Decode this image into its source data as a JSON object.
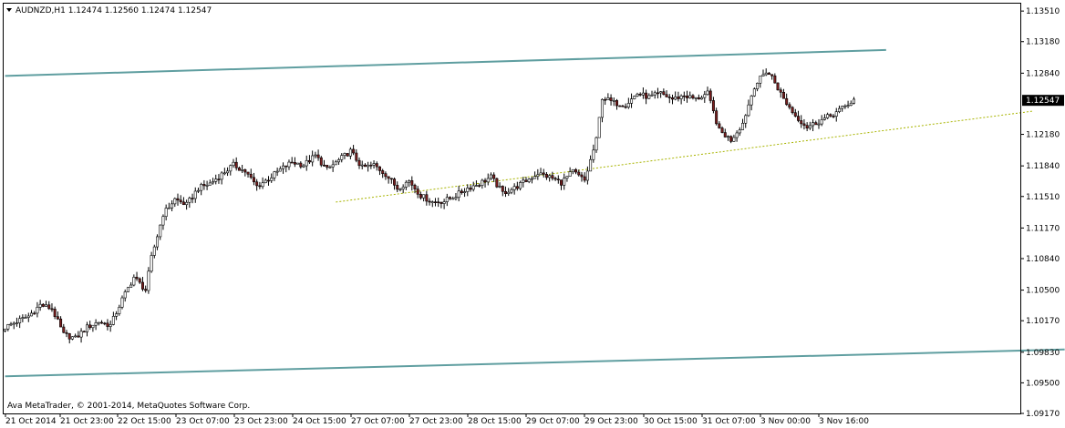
{
  "chart_data": {
    "type": "candlestick",
    "symbol": "AUDNZD",
    "timeframe": "H1",
    "header_text": "AUDNZD,H1  1.12474 1.12560 1.12474 1.12547",
    "ohlc_open": "1.12474",
    "ohlc_high": "1.12560",
    "ohlc_low": "1.12474",
    "ohlc_close": "1.12547",
    "current_price": "1.12547",
    "copyright": "Ava MetaTrader, © 2001-2014, MetaQuotes Software Corp.",
    "y_ticks": [
      "1.13510",
      "1.13180",
      "1.12840",
      "1.12180",
      "1.11840",
      "1.11510",
      "1.11170",
      "1.10840",
      "1.10500",
      "1.10170",
      "1.09830",
      "1.09500",
      "1.09170"
    ],
    "x_ticks": [
      "21 Oct 2014",
      "21 Oct 23:00",
      "22 Oct 15:00",
      "23 Oct 07:00",
      "23 Oct 23:00",
      "24 Oct 15:00",
      "27 Oct 07:00",
      "27 Oct 23:00",
      "28 Oct 15:00",
      "29 Oct 07:00",
      "29 Oct 23:00",
      "30 Oct 15:00",
      "31 Oct 07:00",
      "3 Nov 00:00",
      "3 Nov 16:00"
    ],
    "ylim": [
      1.0917,
      1.1359
    ],
    "close_path": [
      [
        0,
        1.101
      ],
      [
        4,
        1.1016
      ],
      [
        8,
        1.1022
      ],
      [
        12,
        1.1034
      ],
      [
        16,
        1.103
      ],
      [
        20,
        1.1002
      ],
      [
        24,
        1.0998
      ],
      [
        28,
        1.101
      ],
      [
        32,
        1.1016
      ],
      [
        36,
        1.1012
      ],
      [
        40,
        1.104
      ],
      [
        44,
        1.1064
      ],
      [
        48,
        1.105
      ],
      [
        50,
        1.1085
      ],
      [
        54,
        1.1132
      ],
      [
        58,
        1.1148
      ],
      [
        62,
        1.1142
      ],
      [
        66,
        1.116
      ],
      [
        70,
        1.1165
      ],
      [
        74,
        1.1175
      ],
      [
        78,
        1.1185
      ],
      [
        82,
        1.1178
      ],
      [
        86,
        1.1162
      ],
      [
        90,
        1.117
      ],
      [
        94,
        1.118
      ],
      [
        98,
        1.1188
      ],
      [
        102,
        1.1185
      ],
      [
        106,
        1.1195
      ],
      [
        110,
        1.118
      ],
      [
        114,
        1.119
      ],
      [
        118,
        1.12
      ],
      [
        122,
        1.1182
      ],
      [
        126,
        1.1185
      ],
      [
        130,
        1.1175
      ],
      [
        134,
        1.116
      ],
      [
        138,
        1.1168
      ],
      [
        142,
        1.1152
      ],
      [
        146,
        1.1145
      ],
      [
        150,
        1.1146
      ],
      [
        154,
        1.1152
      ],
      [
        158,
        1.116
      ],
      [
        162,
        1.1165
      ],
      [
        166,
        1.1172
      ],
      [
        170,
        1.1155
      ],
      [
        174,
        1.116
      ],
      [
        178,
        1.1168
      ],
      [
        182,
        1.1176
      ],
      [
        186,
        1.1172
      ],
      [
        190,
        1.1166
      ],
      [
        194,
        1.1178
      ],
      [
        198,
        1.1168
      ],
      [
        202,
        1.1212
      ],
      [
        204,
        1.1258
      ],
      [
        208,
        1.1252
      ],
      [
        212,
        1.125
      ],
      [
        216,
        1.1262
      ],
      [
        220,
        1.1258
      ],
      [
        224,
        1.1262
      ],
      [
        228,
        1.1256
      ],
      [
        232,
        1.126
      ],
      [
        236,
        1.1256
      ],
      [
        240,
        1.1262
      ],
      [
        244,
        1.1222
      ],
      [
        248,
        1.1212
      ],
      [
        252,
        1.123
      ],
      [
        256,
        1.127
      ],
      [
        260,
        1.1286
      ],
      [
        262,
        1.128
      ],
      [
        266,
        1.1256
      ],
      [
        270,
        1.1238
      ],
      [
        274,
        1.1226
      ],
      [
        278,
        1.1232
      ],
      [
        282,
        1.1238
      ],
      [
        286,
        1.1246
      ],
      [
        290,
        1.1255
      ]
    ],
    "upper_channel": {
      "start": [
        0,
        1.1281
      ],
      "end": [
        301,
        1.1309
      ]
    },
    "lower_channel": {
      "start": [
        0,
        1.0957
      ],
      "end": [
        362,
        1.0986
      ]
    },
    "support_line": {
      "start": [
        113,
        1.1145
      ],
      "end": [
        351,
        1.1243
      ]
    },
    "colors": {
      "background": "#ffffff",
      "candle_up_body": "#ffffff",
      "candle_down_body": "#7a1f1f",
      "candle_outline": "#000000",
      "channel_line": "#5f9ea0",
      "support_line": "#a8b400",
      "price_label_bg": "#000000",
      "price_label_text": "#ffffff",
      "axis": "#000000"
    }
  }
}
